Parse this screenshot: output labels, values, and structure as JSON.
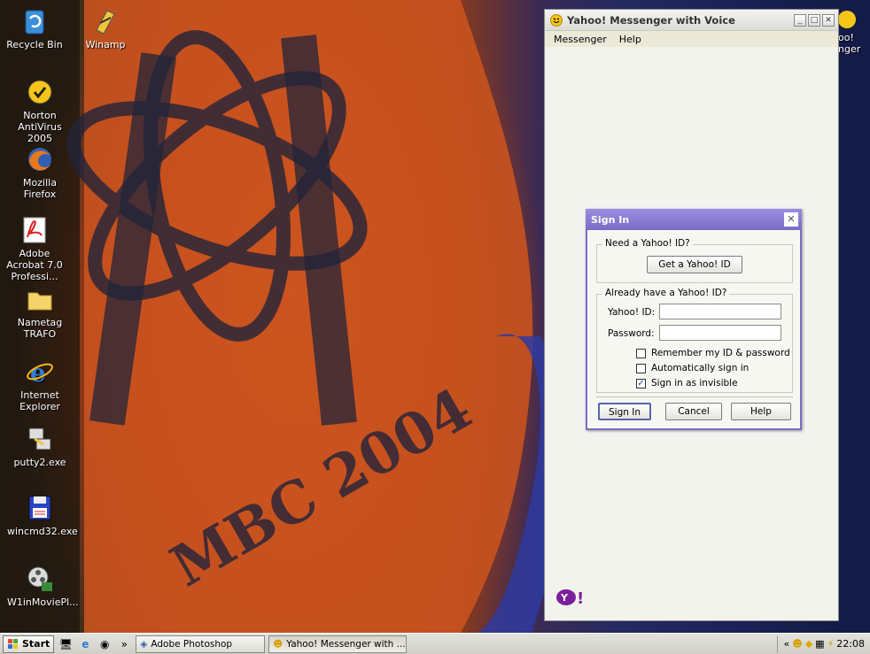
{
  "desktop": {
    "icons": [
      {
        "label": "Recycle Bin",
        "icon": "recycle-bin-icon"
      },
      {
        "label": "Winamp",
        "icon": "winamp-icon"
      },
      {
        "label": "Norton AntiVirus 2005",
        "icon": "norton-icon"
      },
      {
        "label": "Mozilla Firefox",
        "icon": "firefox-icon"
      },
      {
        "label": "Adobe Acrobat 7.0 Professi...",
        "icon": "acrobat-icon"
      },
      {
        "label": "Nametag TRAFO",
        "icon": "folder-icon"
      },
      {
        "label": "Internet Explorer",
        "icon": "ie-icon"
      },
      {
        "label": "putty2.exe",
        "icon": "putty-icon"
      },
      {
        "label": "wincmd32.exe",
        "icon": "floppy-icon"
      },
      {
        "label": "W1inMoviePl...",
        "icon": "movie-icon"
      }
    ],
    "partial_icon_label": "oo! nger",
    "wallpaper_text": "MBC 2004"
  },
  "yahoo_window": {
    "title": "Yahoo! Messenger with Voice",
    "menu": [
      "Messenger",
      "Help"
    ],
    "logo": "Y!"
  },
  "signin": {
    "title": "Sign In",
    "need_id_legend": "Need a Yahoo! ID?",
    "get_id_button": "Get a Yahoo! ID",
    "have_id_legend": "Already have a Yahoo! ID?",
    "yahoo_id_label": "Yahoo! ID:",
    "yahoo_id_value": "",
    "password_label": "Password:",
    "password_value": "",
    "checkboxes": [
      {
        "label": "Remember my ID & password",
        "checked": false
      },
      {
        "label": "Automatically sign in",
        "checked": false
      },
      {
        "label": "Sign in as invisible",
        "checked": true
      }
    ],
    "sign_in_button": "Sign In",
    "cancel_button": "Cancel",
    "help_button": "Help"
  },
  "taskbar": {
    "start_label": "Start",
    "tasks": [
      "Adobe Photoshop",
      "Yahoo! Messenger with ..."
    ],
    "clock": "22:08"
  }
}
